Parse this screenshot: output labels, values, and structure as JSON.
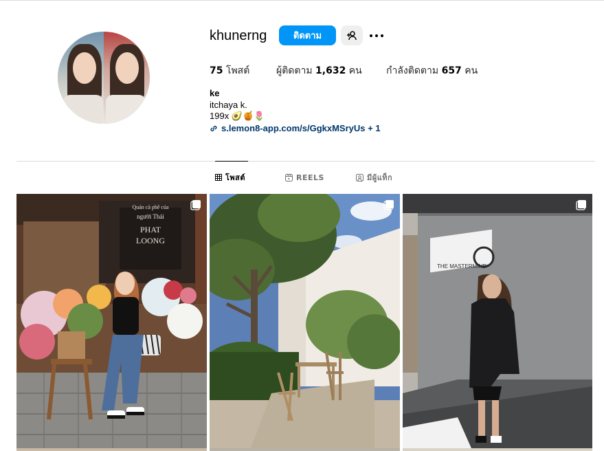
{
  "profile": {
    "username": "khunerng",
    "follow_label": "ติดตาม",
    "posts_count": "75",
    "posts_label": "โพสต์",
    "followers_prefix": "ผู้ติดตาม",
    "followers_count": "1,632",
    "followers_suffix": "คน",
    "following_label": "กำลังติดตาม",
    "following_count": "657",
    "following_suffix": "คน"
  },
  "bio": {
    "name": "ke",
    "line1": "itchaya k.",
    "line2": "199x 🥑🍯🌷",
    "link": "s.lemon8-app.com/s/GgkxMSryUs + 1"
  },
  "tabs": [
    {
      "label": "โพสต์",
      "icon": "grid-icon",
      "active": true
    },
    {
      "label": "REELS",
      "icon": "reels-icon",
      "active": false
    },
    {
      "label": "มีผู้แท็ก",
      "icon": "tagged-icon",
      "active": false
    }
  ],
  "posts": [
    {
      "scene": "flower-shop-cafe",
      "sign_lines": [
        "Quán cà phê của",
        "người Thái",
        "PHAT",
        "LOONG"
      ],
      "multi": true
    },
    {
      "scene": "garden-courtyard",
      "multi": true
    },
    {
      "scene": "building-entrance",
      "sign_text": "THE MASTERMIND",
      "multi": true
    }
  ],
  "colors": {
    "accent": "#0095f6",
    "link": "#00376b",
    "divider": "#dbdbdb"
  }
}
